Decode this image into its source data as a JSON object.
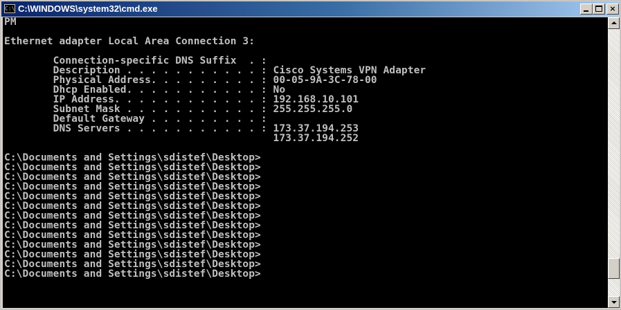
{
  "window": {
    "title": "C:\\WINDOWS\\system32\\cmd.exe",
    "icon": "cmd-console-icon",
    "controls": {
      "minimize": "minimize-icon",
      "maximize": "maximize-icon",
      "close_label": "×"
    }
  },
  "colors": {
    "titlebar_start": "#0a246a",
    "titlebar_end": "#a6caf0",
    "console_background": "#000000",
    "console_text": "#c0c0c0"
  },
  "console": {
    "lines": [
      "PM",
      "",
      "Ethernet adapter Local Area Connection 3:",
      "",
      "        Connection-specific DNS Suffix  . :",
      "        Description . . . . . . . . . . . : Cisco Systems VPN Adapter",
      "        Physical Address. . . . . . . . . : 00-05-9A-3C-78-00",
      "        Dhcp Enabled. . . . . . . . . . . : No",
      "        IP Address. . . . . . . . . . . . : 192.168.10.101",
      "        Subnet Mask . . . . . . . . . . . : 255.255.255.0",
      "        Default Gateway . . . . . . . . . :",
      "        DNS Servers . . . . . . . . . . . : 173.37.194.253",
      "                                            173.37.194.252",
      "",
      "C:\\Documents and Settings\\sdistef\\Desktop>",
      "C:\\Documents and Settings\\sdistef\\Desktop>",
      "C:\\Documents and Settings\\sdistef\\Desktop>",
      "C:\\Documents and Settings\\sdistef\\Desktop>",
      "C:\\Documents and Settings\\sdistef\\Desktop>",
      "C:\\Documents and Settings\\sdistef\\Desktop>",
      "C:\\Documents and Settings\\sdistef\\Desktop>",
      "C:\\Documents and Settings\\sdistef\\Desktop>",
      "C:\\Documents and Settings\\sdistef\\Desktop>",
      "C:\\Documents and Settings\\sdistef\\Desktop>",
      "C:\\Documents and Settings\\sdistef\\Desktop>",
      "C:\\Documents and Settings\\sdistef\\Desktop>",
      "C:\\Documents and Settings\\sdistef\\Desktop>"
    ]
  },
  "scrollbar": {
    "up_icon": "scroll-up-arrow-icon",
    "down_icon": "scroll-down-arrow-icon",
    "position_fraction": 0.93
  }
}
